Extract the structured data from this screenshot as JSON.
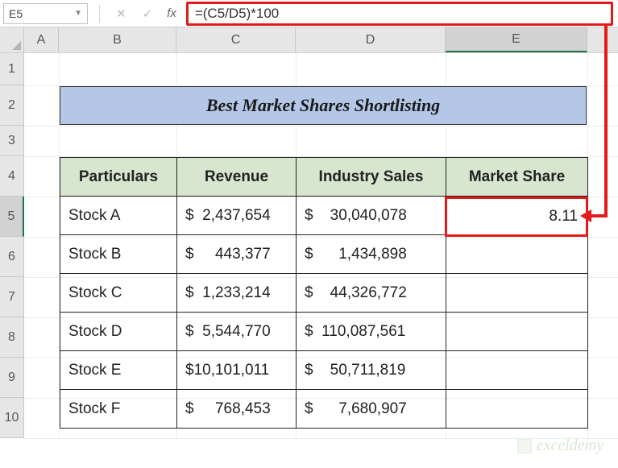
{
  "name_box": "E5",
  "formula_bar": {
    "cancel_icon": "✕",
    "accept_icon": "✓",
    "fx_label": "fx",
    "value": "=(C5/D5)*100"
  },
  "columns": [
    "A",
    "B",
    "C",
    "D",
    "E"
  ],
  "rows": [
    "1",
    "2",
    "3",
    "4",
    "5",
    "6",
    "7",
    "8",
    "9",
    "10"
  ],
  "title": "Best Market Shares Shortlisting",
  "table": {
    "headers": {
      "particulars": "Particulars",
      "revenue": "Revenue",
      "industry": "Industry Sales",
      "market": "Market Share"
    },
    "rows": [
      {
        "part": "Stock A",
        "rev": "$  2,437,654",
        "ind": "$    30,040,078",
        "mkt": "8.11"
      },
      {
        "part": "Stock B",
        "rev": "$     443,377",
        "ind": "$      1,434,898",
        "mkt": ""
      },
      {
        "part": "Stock C",
        "rev": "$  1,233,214",
        "ind": "$    44,326,772",
        "mkt": ""
      },
      {
        "part": "Stock D",
        "rev": "$  5,544,770",
        "ind": "$  110,087,561",
        "mkt": ""
      },
      {
        "part": "Stock E",
        "rev": "$10,101,011",
        "ind": "$    50,711,819",
        "mkt": ""
      },
      {
        "part": "Stock F",
        "rev": "$     768,453",
        "ind": "$      7,680,907",
        "mkt": ""
      }
    ]
  },
  "selected_cell_value": "8.11",
  "watermark": "exceldemy"
}
